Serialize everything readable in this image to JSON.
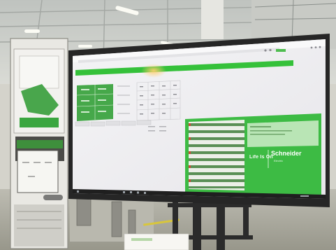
{
  "screen": {
    "slogan": "Life Is On",
    "brand_name": "Schneider",
    "brand_tagline": "Electric"
  },
  "colors": {
    "brand_green": "#3dcd58",
    "panel_green": "#46a84a",
    "header_green": "#35c13a",
    "monitor_bezel": "#262626",
    "ceiling": "#cfd2cc",
    "floor": "#a6a597"
  }
}
